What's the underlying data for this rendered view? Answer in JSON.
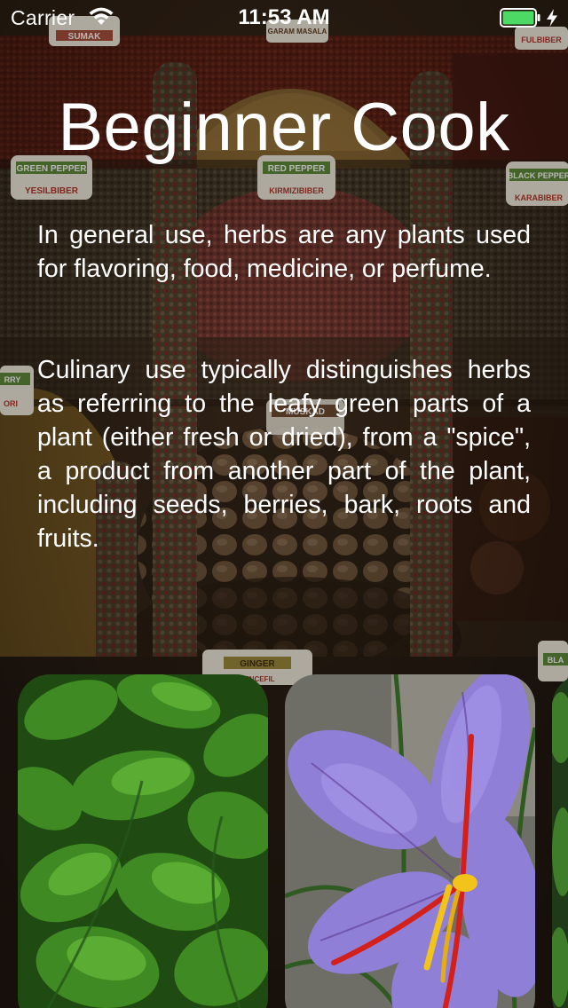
{
  "status_bar": {
    "carrier": "Carrier",
    "time": "11:53 AM",
    "battery_color": "#4cd964"
  },
  "title": "Beginner Cook",
  "paragraphs": [
    "In general use, herbs are any plants used for flavoring, food, medicine, or perfume.",
    "Culinary use typically distinguishes herbs as referring to the leafy green parts of a plant (either fresh or dried), from a \"spice\", a product from another part of the plant, including seeds, berries, bark, roots and fruits."
  ],
  "background_labels": {
    "sumak": "SUMAK",
    "garam_masala": "GARAM MASALA",
    "fulbiber": "FULBIBER",
    "green_pepper": "GREEN PEPPER",
    "yesilbiber": "YESILBIBER",
    "red_pepper": "RED PEPPER",
    "kirmizibiber": "KIRMIZIBIBER",
    "black_pepper": "BLACK PEPPER",
    "karabiber": "KARABIBER",
    "curry": "RRY",
    "curry_sub": "ORI",
    "muskad": "MUSKAD",
    "ginger": "GINGER",
    "ginger_sub": "ZENCEFIL",
    "bla": "BLA"
  },
  "carousel": {
    "cards": [
      {
        "subject": "basil-plant"
      },
      {
        "subject": "saffron-crocus-flower"
      },
      {
        "subject": "herb-partial"
      }
    ]
  }
}
